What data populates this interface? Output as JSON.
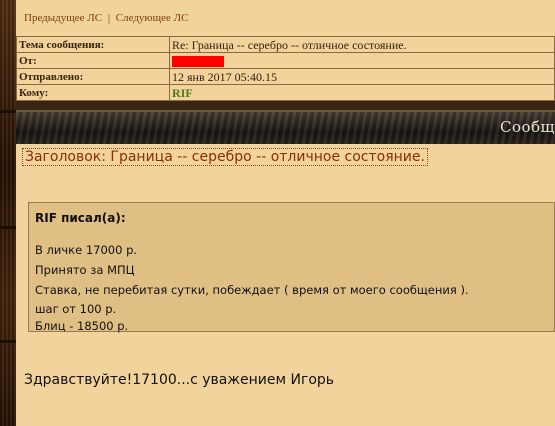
{
  "nav": {
    "prev_label": "Предыдущее ЛС",
    "separator": "|",
    "next_label": "Следующее ЛС"
  },
  "header": {
    "rows": [
      {
        "label": "Тема сообщения:",
        "value": "Re: Граница -- серебро -- отличное состояние."
      },
      {
        "label": "От:",
        "value": ""
      },
      {
        "label": "Отправлено:",
        "value": "12 янв 2017 05:40.15"
      },
      {
        "label": "Кому:",
        "value": "RIF"
      }
    ]
  },
  "titlebar": {
    "caption": "Сообщ"
  },
  "message": {
    "subject": "Заголовок: Граница -- серебро -- отличное состояние.",
    "quote": {
      "author": "RIF писал(а):",
      "lines": [
        "В личке 17000 р.",
        "Принято за МПЦ",
        "Ставка, не перебитая сутки, побеждает ( время от моего сообщения ).",
        "шаг от 100 р.",
        "Блиц - 18500 р."
      ]
    },
    "reply": "Здравствуйте!17100...с уважением Игорь"
  },
  "colors": {
    "panel": "#f1d39b",
    "quote_bg": "#e0bf85",
    "redacted": "#ff0000",
    "link": "#7a3c10",
    "subject": "#8a2e0a",
    "username": "#4e7a1c"
  }
}
